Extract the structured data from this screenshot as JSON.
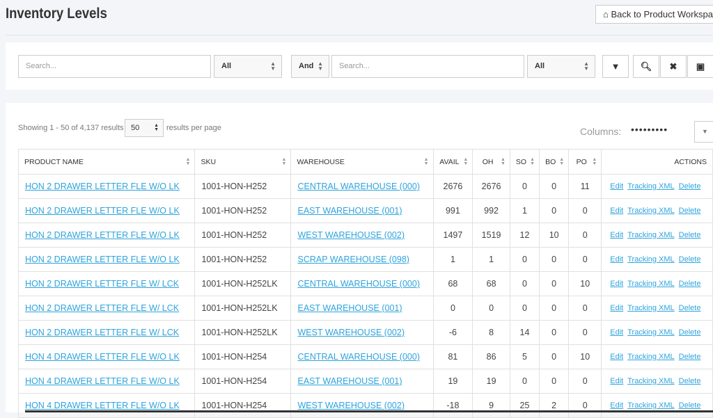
{
  "header": {
    "title": "Inventory Levels",
    "back_label": "Back to Product Workspace",
    "back_icon": "home-icon"
  },
  "filters": {
    "search1_placeholder": "Search...",
    "select1": "All",
    "logic": "And",
    "search2_placeholder": "Search...",
    "select2": "All",
    "icons": [
      "filter-icon",
      "search-icon",
      "clear-icon",
      "save-icon"
    ]
  },
  "paging": {
    "showing": "Showing 1 - 50 of 4,137 results",
    "per_page": "50",
    "per_page_label": "results per page",
    "columns_label": "Columns:",
    "columns_dots": "•••••••••"
  },
  "table": {
    "headers": [
      "PRODUCT NAME",
      "SKU",
      "WAREHOUSE",
      "AVAIL",
      "OH",
      "SO",
      "BO",
      "PO",
      "ACTIONS"
    ],
    "actions": [
      "Edit",
      "Tracking XML",
      "Delete"
    ],
    "rows": [
      [
        "HON 2 DRAWER LETTER FLE W/O LK",
        "1001-HON-H252",
        "CENTRAL WAREHOUSE (000)",
        "2676",
        "2676",
        "0",
        "0",
        "11"
      ],
      [
        "HON 2 DRAWER LETTER FLE W/O LK",
        "1001-HON-H252",
        "EAST WAREHOUSE (001)",
        "991",
        "992",
        "1",
        "0",
        "0"
      ],
      [
        "HON 2 DRAWER LETTER FLE W/O LK",
        "1001-HON-H252",
        "WEST WAREHOUSE (002)",
        "1497",
        "1519",
        "12",
        "10",
        "0"
      ],
      [
        "HON 2 DRAWER LETTER FLE W/O LK",
        "1001-HON-H252",
        "SCRAP WAREHOUSE (098)",
        "1",
        "1",
        "0",
        "0",
        "0"
      ],
      [
        "HON 2 DRAWER LETTER FLE W/ LCK",
        "1001-HON-H252LK",
        "CENTRAL WAREHOUSE (000)",
        "68",
        "68",
        "0",
        "0",
        "10"
      ],
      [
        "HON 2 DRAWER LETTER FLE W/ LCK",
        "1001-HON-H252LK",
        "EAST WAREHOUSE (001)",
        "0",
        "0",
        "0",
        "0",
        "0"
      ],
      [
        "HON 2 DRAWER LETTER FLE W/ LCK",
        "1001-HON-H252LK",
        "WEST WAREHOUSE (002)",
        "-6",
        "8",
        "14",
        "0",
        "0"
      ],
      [
        "HON 4 DRAWER LETTER FLE W/O LK",
        "1001-HON-H254",
        "CENTRAL WAREHOUSE (000)",
        "81",
        "86",
        "5",
        "0",
        "10"
      ],
      [
        "HON 4 DRAWER LETTER FLE W/O LK",
        "1001-HON-H254",
        "EAST WAREHOUSE (001)",
        "19",
        "19",
        "0",
        "0",
        "0"
      ],
      [
        "HON 4 DRAWER LETTER FLE W/O LK",
        "1001-HON-H254",
        "WEST WAREHOUSE (002)",
        "-18",
        "9",
        "25",
        "2",
        "0"
      ]
    ]
  }
}
